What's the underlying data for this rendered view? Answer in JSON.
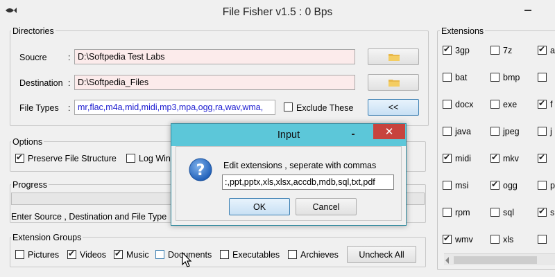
{
  "window": {
    "title": "File Fisher v1.5 : 0 Bps",
    "colors": {
      "dialog_title": "#5cc7d9",
      "close": "#c7433d",
      "pink_field": "#fcebeb",
      "extension_text": "#1b1bd0"
    }
  },
  "directories": {
    "group_label": "Directories",
    "source_label": "Soucre",
    "source_value": "D:\\Softpedia Test Labs",
    "destination_label": "Destination",
    "destination_value": "D:\\Softpedia_Files",
    "filetypes_label": "File Types",
    "filetypes_value": "mr,flac,m4a,mid,midi,mp3,mpa,ogg,ra,wav,wma,",
    "colon": ":",
    "exclude_label": "Exclude These",
    "move_button": "<<"
  },
  "options": {
    "group_label": "Options",
    "preserve_label": "Preserve File Structure",
    "log_label": "Log Win"
  },
  "progress": {
    "group_label": "Progress",
    "status": "Enter Source , Destination and File Type"
  },
  "extension_groups": {
    "group_label": "Extension Groups",
    "items": [
      {
        "label": "Pictures",
        "checked": false
      },
      {
        "label": "Videos",
        "checked": true
      },
      {
        "label": "Music",
        "checked": true
      },
      {
        "label": "Documents",
        "checked": false
      },
      {
        "label": "Executables",
        "checked": false
      },
      {
        "label": "Archieves",
        "checked": false
      }
    ],
    "uncheck_all": "Uncheck All"
  },
  "extensions": {
    "group_label": "Extensions",
    "rows": [
      [
        {
          "label": "3gp",
          "checked": true
        },
        {
          "label": "7z",
          "checked": false
        },
        {
          "label": "a",
          "checked": true
        }
      ],
      [
        {
          "label": "bat",
          "checked": false
        },
        {
          "label": "bmp",
          "checked": false
        },
        {
          "label": "",
          "checked": false
        }
      ],
      [
        {
          "label": "docx",
          "checked": false
        },
        {
          "label": "exe",
          "checked": false
        },
        {
          "label": "f",
          "checked": true
        }
      ],
      [
        {
          "label": "java",
          "checked": false
        },
        {
          "label": "jpeg",
          "checked": false
        },
        {
          "label": "j",
          "checked": false
        }
      ],
      [
        {
          "label": "midi",
          "checked": true
        },
        {
          "label": "mkv",
          "checked": true
        },
        {
          "label": "",
          "checked": true
        }
      ],
      [
        {
          "label": "msi",
          "checked": false
        },
        {
          "label": "ogg",
          "checked": true
        },
        {
          "label": "p",
          "checked": false
        }
      ],
      [
        {
          "label": "rpm",
          "checked": false
        },
        {
          "label": "sql",
          "checked": false
        },
        {
          "label": "s",
          "checked": true
        }
      ],
      [
        {
          "label": "wmv",
          "checked": true
        },
        {
          "label": "xls",
          "checked": false
        },
        {
          "label": "",
          "checked": false
        }
      ]
    ]
  },
  "dialog": {
    "title": "Input",
    "close_glyph": "✕",
    "prompt": "Edit extensions , seperate with commas",
    "input_value": ":,ppt,pptx,xls,xlsx,accdb,mdb,sql,txt,pdf",
    "ok_label": "OK",
    "cancel_label": "Cancel"
  }
}
